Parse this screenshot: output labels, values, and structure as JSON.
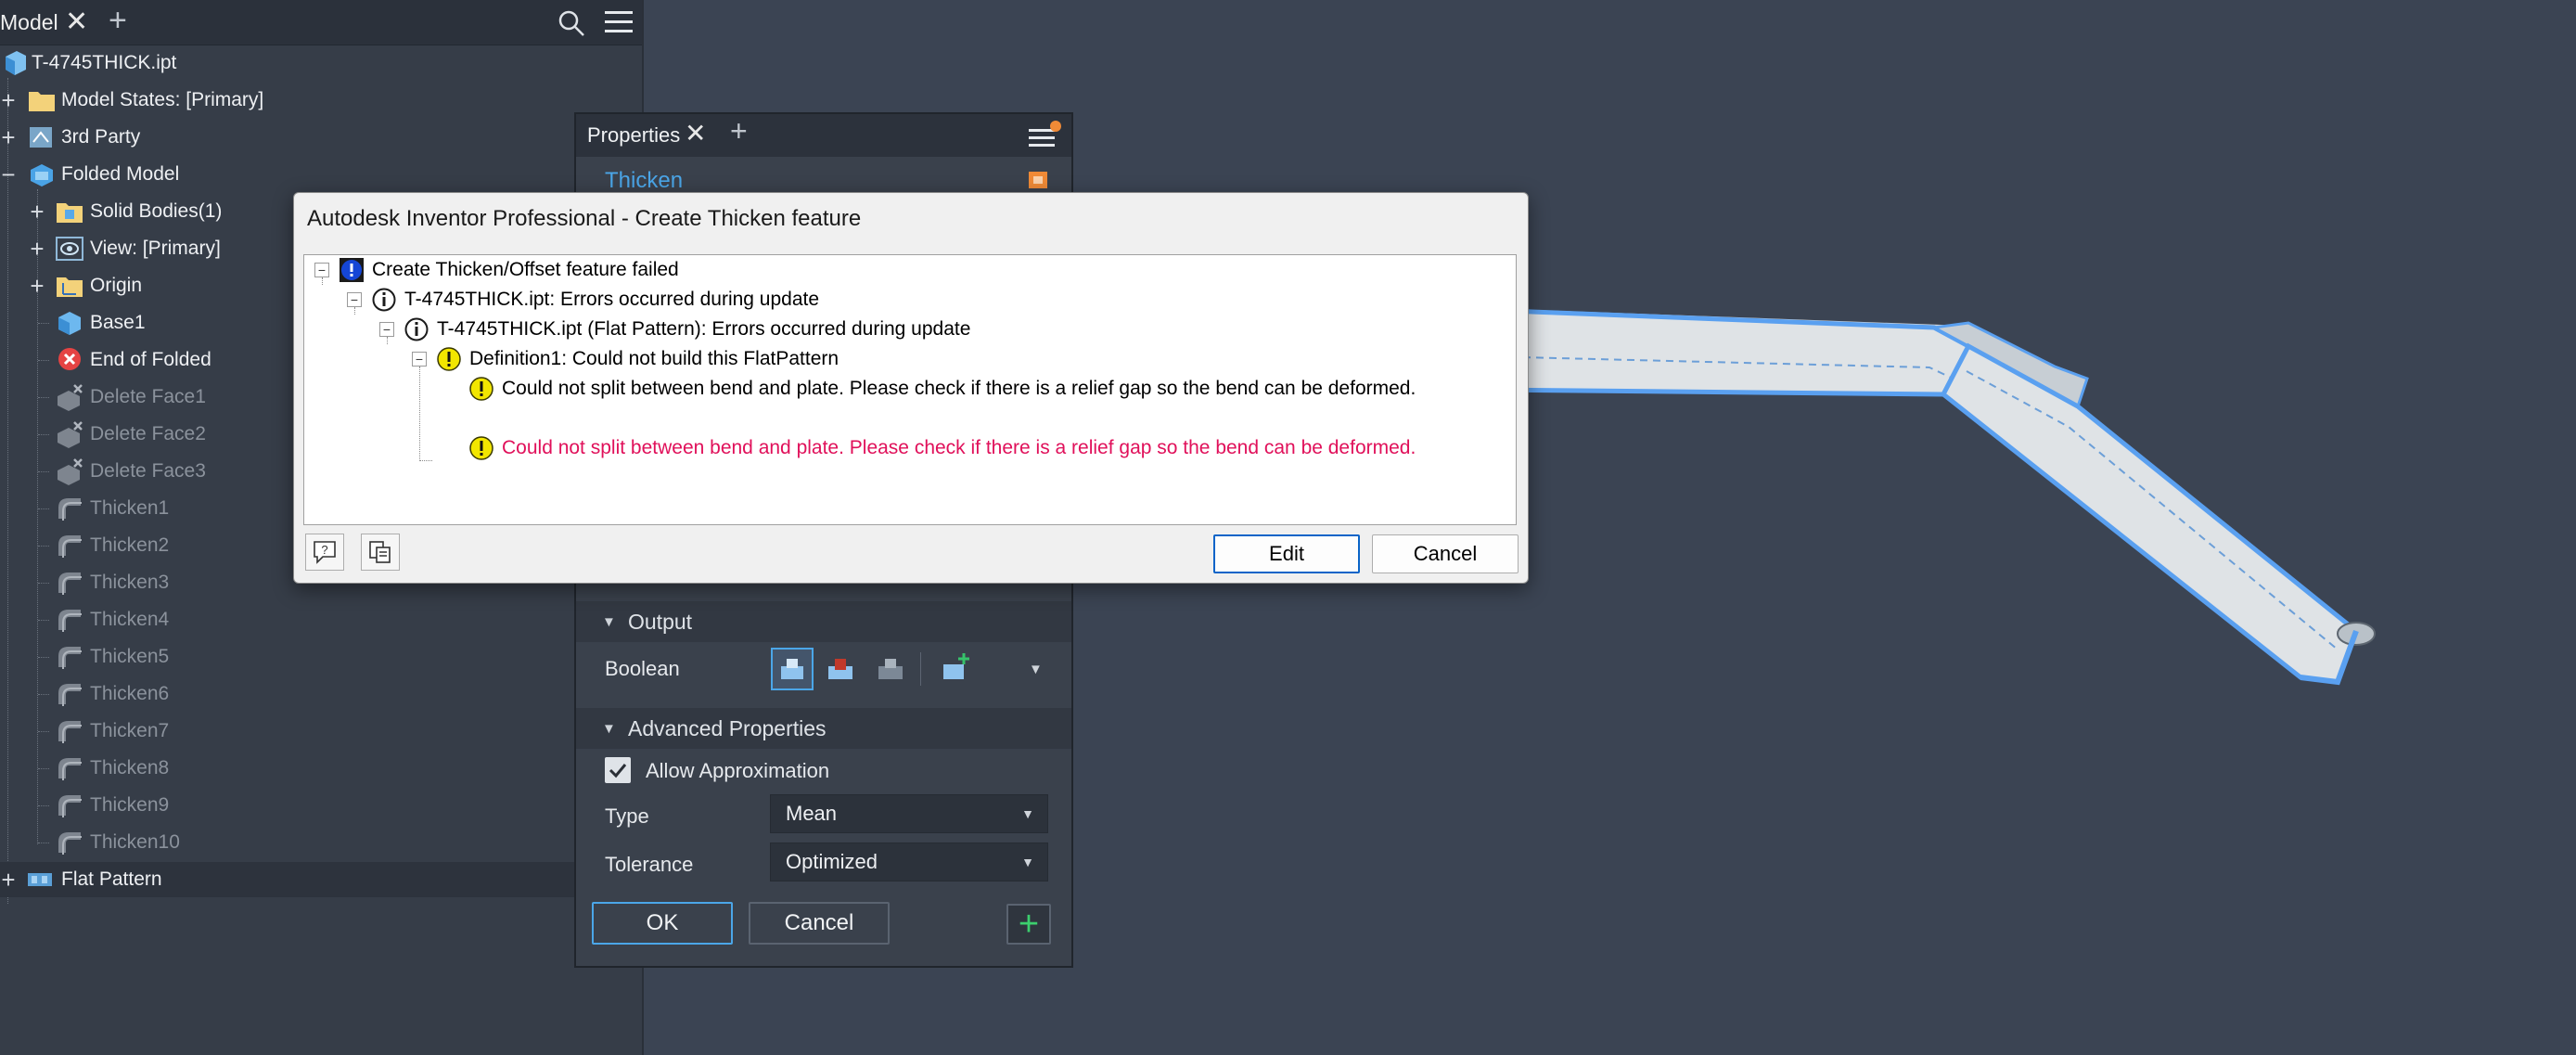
{
  "browser": {
    "tab_label": "Model",
    "close_glyph": "✕",
    "add_glyph": "+",
    "search_icon": "search-icon",
    "menu_icon": "hamburger-menu-icon",
    "tree": [
      {
        "label": "T-4745THICK.ipt",
        "icon": "part-icon",
        "level": 0,
        "state": "normal"
      },
      {
        "label": "Model States: [Primary]",
        "icon": "folder-icon",
        "level": 1,
        "state": "normal"
      },
      {
        "label": "3rd Party",
        "icon": "third-party-icon",
        "level": 1,
        "state": "normal"
      },
      {
        "label": "Folded Model",
        "icon": "folded-model-icon",
        "level": 1,
        "state": "normal"
      },
      {
        "label": "Solid Bodies(1)",
        "icon": "folder-icon",
        "level": 2,
        "state": "normal"
      },
      {
        "label": "View: [Primary]",
        "icon": "view-icon",
        "level": 2,
        "state": "normal"
      },
      {
        "label": "Origin",
        "icon": "origin-icon",
        "level": 2,
        "state": "normal"
      },
      {
        "label": "Base1",
        "icon": "base-feature-icon",
        "level": 2,
        "state": "normal"
      },
      {
        "label": "End of Folded",
        "icon": "end-of-part-error-icon",
        "level": 2,
        "state": "normal"
      },
      {
        "label": "Delete Face1",
        "icon": "delete-face-icon",
        "level": 2,
        "state": "suppressed"
      },
      {
        "label": "Delete Face2",
        "icon": "delete-face-icon",
        "level": 2,
        "state": "suppressed"
      },
      {
        "label": "Delete Face3",
        "icon": "delete-face-icon",
        "level": 2,
        "state": "suppressed"
      },
      {
        "label": "Thicken1",
        "icon": "thicken-icon",
        "level": 2,
        "state": "suppressed"
      },
      {
        "label": "Thicken2",
        "icon": "thicken-icon",
        "level": 2,
        "state": "suppressed"
      },
      {
        "label": "Thicken3",
        "icon": "thicken-icon",
        "level": 2,
        "state": "suppressed"
      },
      {
        "label": "Thicken4",
        "icon": "thicken-icon",
        "level": 2,
        "state": "suppressed"
      },
      {
        "label": "Thicken5",
        "icon": "thicken-icon",
        "level": 2,
        "state": "suppressed"
      },
      {
        "label": "Thicken6",
        "icon": "thicken-icon",
        "level": 2,
        "state": "suppressed"
      },
      {
        "label": "Thicken7",
        "icon": "thicken-icon",
        "level": 2,
        "state": "suppressed"
      },
      {
        "label": "Thicken8",
        "icon": "thicken-icon",
        "level": 2,
        "state": "suppressed"
      },
      {
        "label": "Thicken9",
        "icon": "thicken-icon",
        "level": 2,
        "state": "suppressed"
      },
      {
        "label": "Thicken10",
        "icon": "thicken-icon",
        "level": 2,
        "state": "suppressed"
      },
      {
        "label": "Flat Pattern",
        "icon": "flat-pattern-icon",
        "level": 1,
        "state": "selected"
      }
    ]
  },
  "properties": {
    "tab_label": "Properties",
    "close_glyph": "✕",
    "add_glyph": "+",
    "feature_title": "Thicken",
    "output_header": "Output",
    "boolean_label": "Boolean",
    "advanced_header": "Advanced Properties",
    "allow_approx_label": "Allow Approximation",
    "allow_approx_checked": true,
    "type_label": "Type",
    "type_value": "Mean",
    "tolerance_label": "Tolerance",
    "tolerance_value": "Optimized",
    "ok_label": "OK",
    "cancel_label": "Cancel",
    "add_glyph_btn": "+"
  },
  "dialog": {
    "title": "Autodesk Inventor Professional - Create Thicken feature",
    "messages": [
      {
        "text": "Create Thicken/Offset feature failed",
        "icon": "error-info-icon",
        "kind": "normal"
      },
      {
        "text": "T-4745THICK.ipt: Errors occurred during update",
        "icon": "info-icon",
        "kind": "normal"
      },
      {
        "text": "T-4745THICK.ipt (Flat Pattern): Errors occurred during update",
        "icon": "info-icon",
        "kind": "normal"
      },
      {
        "text": "Definition1: Could not build this FlatPattern",
        "icon": "warning-icon",
        "kind": "normal"
      },
      {
        "text": "Could not split between bend and plate. Please check if there is a relief gap so the bend can be deformed.",
        "icon": "warning-icon",
        "kind": "normal"
      },
      {
        "text": "Could not split between bend and plate. Please check if there is a relief gap so the bend can be deformed.",
        "icon": "warning-icon",
        "kind": "error"
      }
    ],
    "edit_label": "Edit",
    "cancel_label": "Cancel"
  },
  "colors": {
    "accent_blue": "#4ba6e8",
    "error_text": "#e0105a",
    "warning_yellow": "#f2e600",
    "model_highlight": "#5aa0f0"
  }
}
